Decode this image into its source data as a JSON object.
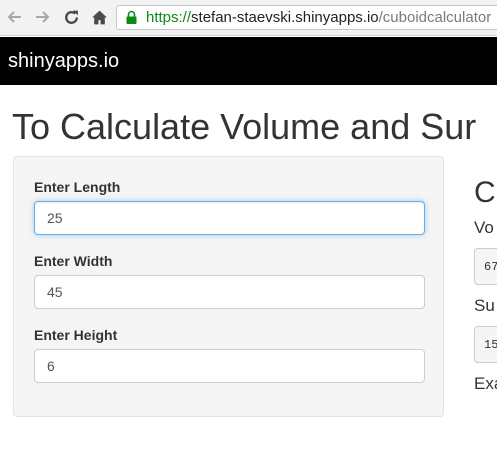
{
  "browser": {
    "url_scheme": "https://",
    "url_host": "stefan-staevski.shinyapps.io",
    "url_path": "/cuboidcalculator"
  },
  "navbar": {
    "brand": "shinyapps.io"
  },
  "page": {
    "title": "To Calculate Volume and Sur"
  },
  "sidebar": {
    "fields": [
      {
        "label": "Enter Length",
        "value": "25"
      },
      {
        "label": "Enter Width",
        "value": "45"
      },
      {
        "label": "Enter Height",
        "value": "6"
      }
    ]
  },
  "main": {
    "heading": "C",
    "outputs": [
      {
        "label": "Vo",
        "value": "67"
      },
      {
        "label": "Su",
        "value": "15"
      },
      {
        "label": "Exa",
        "value": ""
      }
    ]
  },
  "colors": {
    "navbar_bg": "#000000",
    "url_secure_green": "#0b8a18",
    "focus_border": "#66afe9",
    "panel_bg": "#f5f5f5"
  }
}
